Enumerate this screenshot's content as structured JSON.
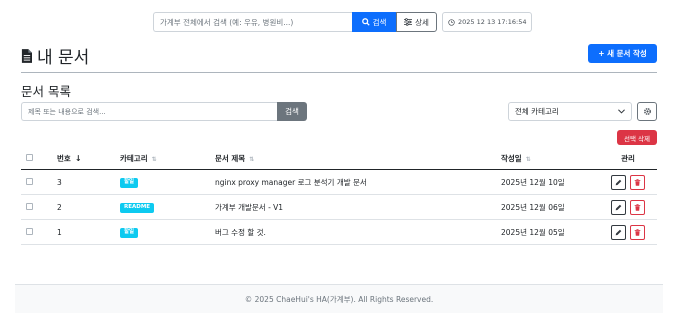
{
  "header": {
    "search_placeholder": "가계부 전체에서 검색 (예: 우유, 병원비...)",
    "search_button": "검색",
    "detail_button": "상세",
    "clock": "2025 12 13 17:16:54"
  },
  "page": {
    "title": "내 문서",
    "new_button": "+ 새 문서 작성",
    "section_title": "문서 목록"
  },
  "filter": {
    "placeholder": "제목 또는 내용으로 검색...",
    "button": "검색",
    "category_selected": "전체 카테고리",
    "bulk_delete": "선택 삭제"
  },
  "table": {
    "headers": {
      "number": "번호",
      "category": "카테고리",
      "title": "문서 제목",
      "date": "작성일",
      "actions": "관리"
    },
    "rows": [
      {
        "number": "3",
        "category": "할일",
        "title": "nginx proxy manager 로그 분석기 개발 문서",
        "date": "2025년 12월 10일"
      },
      {
        "number": "2",
        "category": "README",
        "title": "가계부 개발문서 - V1",
        "date": "2025년 12월 06일"
      },
      {
        "number": "1",
        "category": "할일",
        "title": "버그 수정 할 것.",
        "date": "2025년 12월 05일"
      }
    ]
  },
  "footer": {
    "text": "© 2025 ChaeHui's HA(가계부). All Rights Reserved."
  },
  "colors": {
    "primary": "#0d6efd",
    "secondary": "#6c757d",
    "danger": "#dc3545",
    "info_badge": "#0dcaf0"
  }
}
